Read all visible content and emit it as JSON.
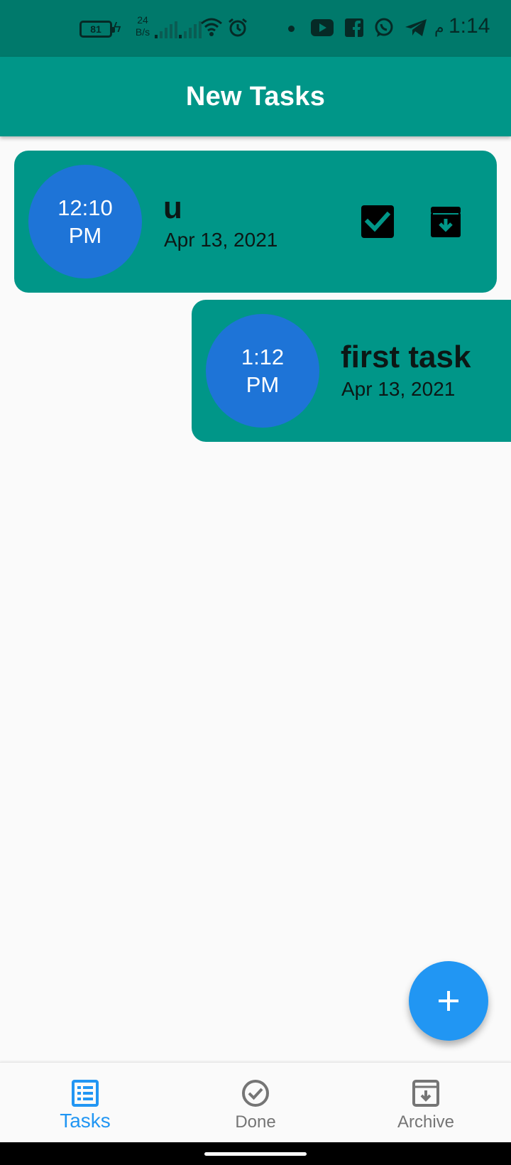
{
  "status_bar": {
    "battery": "81",
    "speed_value": "24",
    "speed_unit": "B/s",
    "timezone_glyph": "م",
    "time": "1:14",
    "icons": [
      "battery-icon",
      "charging-bolt-icon",
      "signal-icon",
      "signal-icon",
      "wifi-icon",
      "alarm-icon",
      "notification-dot-icon",
      "youtube-icon",
      "facebook-icon",
      "whatsapp-icon",
      "telegram-icon"
    ]
  },
  "app_bar": {
    "title": "New Tasks"
  },
  "tasks": [
    {
      "time_line1": "12:10",
      "time_line2": "PM",
      "title": "u",
      "date": "Apr 13, 2021",
      "actions": [
        "check-box-icon",
        "archive-icon"
      ]
    },
    {
      "time_line1": "1:12",
      "time_line2": "PM",
      "title": "first task",
      "date": "Apr 13, 2021"
    }
  ],
  "fab": {
    "icon": "plus-icon"
  },
  "bottom_nav": {
    "items": [
      {
        "label": "Tasks",
        "icon": "list-icon",
        "active": true
      },
      {
        "label": "Done",
        "icon": "check-circle-icon",
        "active": false
      },
      {
        "label": "Archive",
        "icon": "archive-icon",
        "active": false
      }
    ]
  },
  "colors": {
    "status_bar": "#00796b",
    "app_bar": "#009688",
    "card": "#009688",
    "time_circle": "#1e74d7",
    "accent": "#2196f3",
    "inactive": "#757575",
    "background": "#fafafa"
  }
}
